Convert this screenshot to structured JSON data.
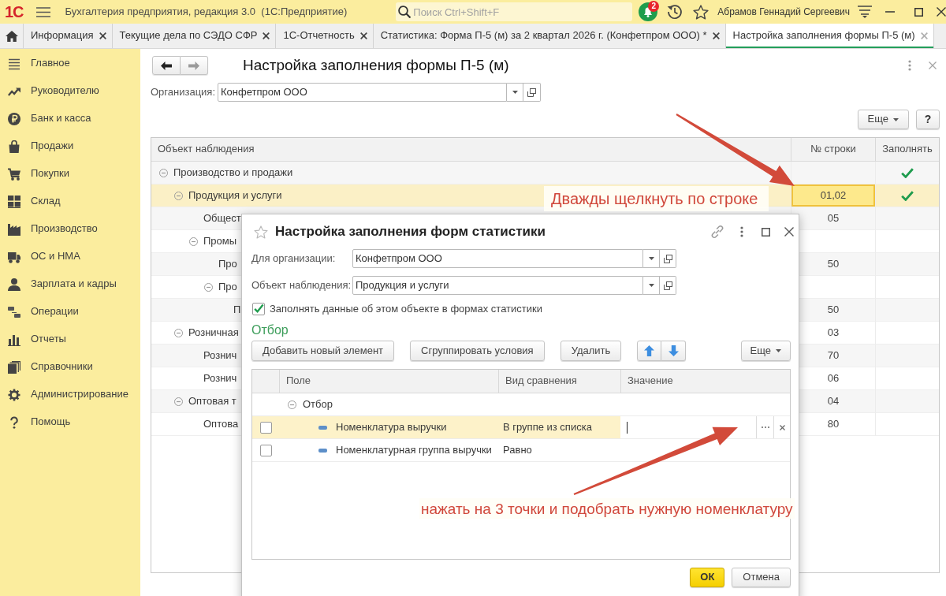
{
  "app_bar": {
    "logo": "1С",
    "title": "Бухгалтерия предприятия, редакция 3.0  (1С:Предприятие)",
    "search": {
      "placeholder": "Поиск Ctrl+Shift+F"
    },
    "notifications": {
      "count": "2"
    },
    "user": "Абрамов Геннадий Сергеевич"
  },
  "tabs": [
    {
      "label": "Информация",
      "selected": false
    },
    {
      "label": "Текущие дела по СЭДО СФР",
      "selected": false
    },
    {
      "label": "1С-Отчетность",
      "selected": false
    },
    {
      "label": "Статистика: Форма П-5 (м) за 2 квартал 2026 г. (Конфетпром ООО) *",
      "selected": false
    },
    {
      "label": "Настройка заполнения формы П-5 (м)",
      "selected": true
    }
  ],
  "sidebar": {
    "items": [
      {
        "label": "Главное",
        "selected": false
      },
      {
        "label": "Руководителю",
        "selected": false
      },
      {
        "label": "Банк и касса",
        "selected": false
      },
      {
        "label": "Продажи",
        "selected": false
      },
      {
        "label": "Покупки",
        "selected": false
      },
      {
        "label": "Склад",
        "selected": false
      },
      {
        "label": "Производство",
        "selected": false
      },
      {
        "label": "ОС и НМА",
        "selected": false
      },
      {
        "label": "Зарплата и кадры",
        "selected": false
      },
      {
        "label": "Операции",
        "selected": false
      },
      {
        "label": "Отчеты",
        "selected": false
      },
      {
        "label": "Справочники",
        "selected": false
      },
      {
        "label": "Администрирование",
        "selected": false
      },
      {
        "label": "Помощь",
        "selected": false
      }
    ]
  },
  "form": {
    "title": "Настройка заполнения формы П-5 (м)",
    "organization": {
      "label": "Организация:",
      "value": "Конфетпром ООО"
    },
    "more_button": "Еще",
    "help_button": "?",
    "table": {
      "columns": [
        "Объект наблюдения",
        "№ строки",
        "Заполнять"
      ],
      "rows": [
        {
          "name": "Производство и продажи",
          "fill": true,
          "selected": false,
          "expanded": true,
          "children": [
            {
              "name": "Продукция и услуги",
              "line": "01,02",
              "fill": true,
              "selected": true,
              "expanded": true,
              "children": [
                {
                  "name": "Общест",
                  "line": "05",
                  "fill": false,
                  "selected": false
                },
                {
                  "name": "Промы",
                  "fill": false,
                  "selected": false,
                  "expanded": true,
                  "children": [
                    {
                      "name": "Про",
                      "line": "50",
                      "fill": false,
                      "selected": false
                    },
                    {
                      "name": "Про",
                      "fill": false,
                      "selected": false,
                      "expanded": true,
                      "children": [
                        {
                          "name": "П",
                          "line": "50",
                          "fill": false,
                          "selected": false
                        }
                      ]
                    }
                  ]
                }
              ]
            },
            {
              "name": "Розничная",
              "line": "03",
              "fill": false,
              "selected": false,
              "expanded": true,
              "children": [
                {
                  "name": "Рознич",
                  "line": "70",
                  "fill": false,
                  "selected": false
                },
                {
                  "name": "Рознич",
                  "line": "06",
                  "fill": false,
                  "selected": false
                }
              ]
            },
            {
              "name": "Оптовая т",
              "line": "04",
              "fill": false,
              "selected": false,
              "expanded": true,
              "children": [
                {
                  "name": "Оптова",
                  "line": "80",
                  "fill": false,
                  "selected": false
                }
              ]
            }
          ]
        }
      ]
    }
  },
  "dialog": {
    "title": "Настройка заполнения форм статистики",
    "fields": [
      {
        "label": "Для организации:",
        "value": "Конфетпром ООО"
      },
      {
        "label": "Объект наблюдения:",
        "value": "Продукция и услуги"
      }
    ],
    "fill_checkbox": {
      "label": "Заполнять данные об этом объекте в формах статистики",
      "checked": true
    },
    "filter": {
      "heading": "Отбор",
      "buttons": [
        "Добавить новый элемент",
        "Сгруппировать условия",
        "Удалить"
      ],
      "more_button": "Еще",
      "columns": [
        "Поле",
        "Вид сравнения",
        "Значение"
      ],
      "rows": [
        {
          "field": "Отбор",
          "selected": false,
          "expanded": true,
          "children": [
            {
              "field": "Номенклатура выручки",
              "comparison": "В группе из списка",
              "checked": false,
              "selected": true,
              "editing": true
            },
            {
              "field": "Номенклатурная группа выручки",
              "comparison": "Равно",
              "checked": false,
              "selected": false,
              "editing": false
            }
          ]
        }
      ]
    },
    "buttons": [
      {
        "kind": "default",
        "label": "ОК"
      },
      {
        "kind": "normal",
        "label": "Отмена"
      }
    ]
  },
  "annotations": [
    {
      "text": "Дважды щелкнуть по строке"
    },
    {
      "text": "нажать на 3 точки и подобрать нужную номенклатуру"
    }
  ]
}
